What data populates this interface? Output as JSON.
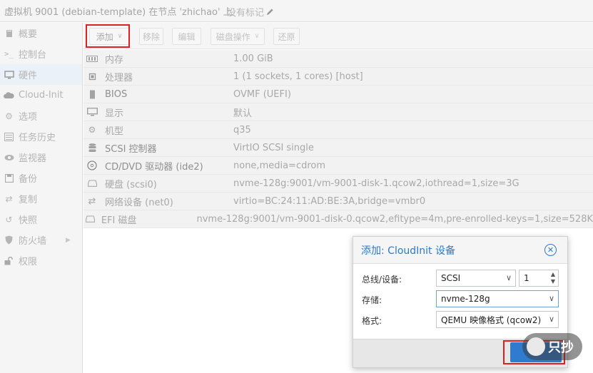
{
  "header": {
    "title": "虚拟机 9001 (debian-template) 在节点 'zhichao' 上",
    "tags_label": "没有标记"
  },
  "sidebar": {
    "items": [
      {
        "label": "概要",
        "icon": "book-icon"
      },
      {
        "label": "控制台",
        "icon": "terminal-icon"
      },
      {
        "label": "硬件",
        "icon": "desktop-icon",
        "active": true
      },
      {
        "label": "Cloud-Init",
        "icon": "cloud-icon"
      },
      {
        "label": "选项",
        "icon": "gear-icon"
      },
      {
        "label": "任务历史",
        "icon": "list-icon"
      },
      {
        "label": "监视器",
        "icon": "eye-icon"
      },
      {
        "label": "备份",
        "icon": "floppy-icon"
      },
      {
        "label": "复制",
        "icon": "retweet-icon"
      },
      {
        "label": "快照",
        "icon": "history-icon"
      },
      {
        "label": "防火墙",
        "icon": "shield-icon",
        "has_arrow": true
      },
      {
        "label": "权限",
        "icon": "unlock-icon"
      }
    ]
  },
  "toolbar": {
    "add": "添加",
    "remove": "移除",
    "edit": "编辑",
    "disk_action": "磁盘操作",
    "revert": "还原"
  },
  "hardware": [
    {
      "icon": "memory-icon",
      "key": "内存",
      "value": "1.00 GiB"
    },
    {
      "icon": "cpu-icon",
      "key": "处理器",
      "value": "1 (1 sockets, 1 cores) [host]"
    },
    {
      "icon": "microchip-icon",
      "key": "BIOS",
      "value": "OVMF (UEFI)"
    },
    {
      "icon": "monitor-icon",
      "key": "显示",
      "value": "默认"
    },
    {
      "icon": "cogs-icon",
      "key": "机型",
      "value": "q35"
    },
    {
      "icon": "database-icon",
      "key": "SCSI 控制器",
      "value": "VirtIO SCSI single"
    },
    {
      "icon": "cdrom-icon",
      "key": "CD/DVD 驱动器 (ide2)",
      "value": "none,media=cdrom"
    },
    {
      "icon": "hdd-icon",
      "key": "硬盘 (scsi0)",
      "value": "nvme-128g:9001/vm-9001-disk-1.qcow2,iothread=1,size=3G"
    },
    {
      "icon": "exchange-icon",
      "key": "网络设备 (net0)",
      "value": "virtio=BC:24:11:AD:BE:3A,bridge=vmbr0"
    },
    {
      "icon": "hdd-icon",
      "key": "EFI 磁盘",
      "value": "nvme-128g:9001/vm-9001-disk-0.qcow2,efitype=4m,pre-enrolled-keys=1,size=528K"
    }
  ],
  "dialog": {
    "title": "添加: CloudInit 设备",
    "bus_label": "总线/设备:",
    "bus_value": "SCSI",
    "device_value": "1",
    "storage_label": "存储:",
    "storage_value": "nvme-128g",
    "format_label": "格式:",
    "format_value": "QEMU 映像格式 (qcow2)"
  },
  "watermark": {
    "text": "只抄"
  },
  "colors": {
    "accent": "#2f79c7",
    "highlight": "#e02020",
    "active_nav": "#eaf1f8"
  }
}
